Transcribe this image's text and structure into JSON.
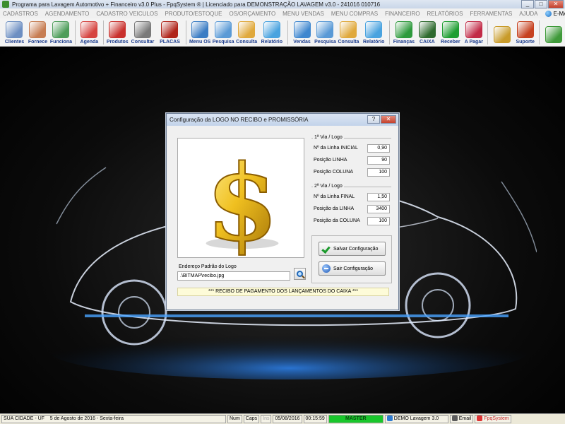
{
  "window": {
    "title": "Programa para Lavagem Automotivo + Financeiro v3.0 Plus - FpqSystem ® | Licenciado para  DEMONSTRAÇÃO LAVAGEM v3.0 - 241016 010716",
    "min": "_",
    "max": "□",
    "close": "✕"
  },
  "menu": {
    "items": [
      "CADASTROS",
      "AGENDAMENTO",
      "CADASTRO VEICULOS",
      "PRODUTO/ESTOQUE",
      "OS/ORÇAMENTO",
      "MENU VENDAS",
      "MENU COMPRAS",
      "FINANCEIRO",
      "RELATÓRIOS",
      "FERRAMENTAS",
      "AJUDA"
    ],
    "email": "E-MAIL"
  },
  "toolbar": {
    "buttons": [
      {
        "label": "Clientes",
        "icon": "clients-icon",
        "color": "#6d8fc2"
      },
      {
        "label": "Fornece",
        "icon": "supplier-icon",
        "color": "#c77d52"
      },
      {
        "label": "Funciona",
        "icon": "employee-icon",
        "color": "#4e9d5a"
      },
      {
        "label": "Agenda",
        "icon": "calendar-icon",
        "color": "#d64541"
      },
      {
        "label": "Produtos",
        "icon": "products-icon",
        "color": "#c9302c"
      },
      {
        "label": "Consultar",
        "icon": "barcode-icon",
        "color": "#7a7a7a"
      },
      {
        "label": "PLACAS",
        "icon": "car-plate-icon",
        "color": "#b0251b"
      },
      {
        "label": "Menu OS",
        "icon": "clipboard-icon",
        "color": "#3b7dc4"
      },
      {
        "label": "Pesquisa",
        "icon": "search-doc-icon",
        "color": "#5a9ad6"
      },
      {
        "label": "Consulta",
        "icon": "folder-icon",
        "color": "#e0a93c"
      },
      {
        "label": "Relatório",
        "icon": "report-icon",
        "color": "#4aa3df"
      },
      {
        "label": "Vendas",
        "icon": "monitor-icon",
        "color": "#3f87cf"
      },
      {
        "label": "Pesquisa",
        "icon": "search-doc-icon",
        "color": "#5a9ad6"
      },
      {
        "label": "Consulta",
        "icon": "folder-icon",
        "color": "#e0a93c"
      },
      {
        "label": "Relatório",
        "icon": "report-icon",
        "color": "#4aa3df"
      },
      {
        "label": "Finanças",
        "icon": "finance-icon",
        "color": "#2e9a3d"
      },
      {
        "label": "CAIXA",
        "icon": "cash-icon",
        "color": "#2f6b2f"
      },
      {
        "label": "Receber",
        "icon": "receive-icon",
        "color": "#1f9e32"
      },
      {
        "label": "A Pagar",
        "icon": "pay-icon",
        "color": "#c22b47"
      },
      {
        "label": "",
        "icon": "coin-icon",
        "color": "#c89b2a"
      },
      {
        "label": "Suporte",
        "icon": "support-icon",
        "color": "#c6411f"
      },
      {
        "label": "",
        "icon": "exit-icon",
        "color": "#3f9a3a"
      }
    ]
  },
  "dialog": {
    "title": "Configuração da LOGO NO RECIBO e PROMISSÓRIA",
    "help": "?",
    "close": "✕",
    "via1": {
      "title": "1ª Via / Logo",
      "fields": [
        {
          "label": "Nº da Linha INICIAL",
          "value": "0,90"
        },
        {
          "label": "Posição LINHA",
          "value": "90"
        },
        {
          "label": "Posição COLUNA",
          "value": "100"
        }
      ]
    },
    "via2": {
      "title": "2ª Via / Logo",
      "fields": [
        {
          "label": "Nº da Linha FINAL",
          "value": "1,50"
        },
        {
          "label": "Posição da LINHA",
          "value": "3400"
        },
        {
          "label": "Posição da COLUNA",
          "value": "100"
        }
      ]
    },
    "save_button": "Salvar Configuração",
    "exit_button": "Sair Configuração",
    "path_label": "Endereço Padrão do Logo",
    "path_value": ".\\BITMAP\\recibo.jpg",
    "footer": "*** RECIBO DE PAGAMENTO DOS LANÇAMENTOS DO CAIXA ***"
  },
  "status": {
    "city": "SUA CIDADE - UF",
    "date_long": "5 de Agosto de 2016 - Sexta-feira",
    "num": "Num",
    "caps": "Caps",
    "ins": "Ins",
    "date": "05/08/2016",
    "time": "00:15:59",
    "master": "MASTER",
    "demo": "DEMO Lavagem 3.0",
    "email": "Email",
    "brand": "FpqSystem"
  }
}
